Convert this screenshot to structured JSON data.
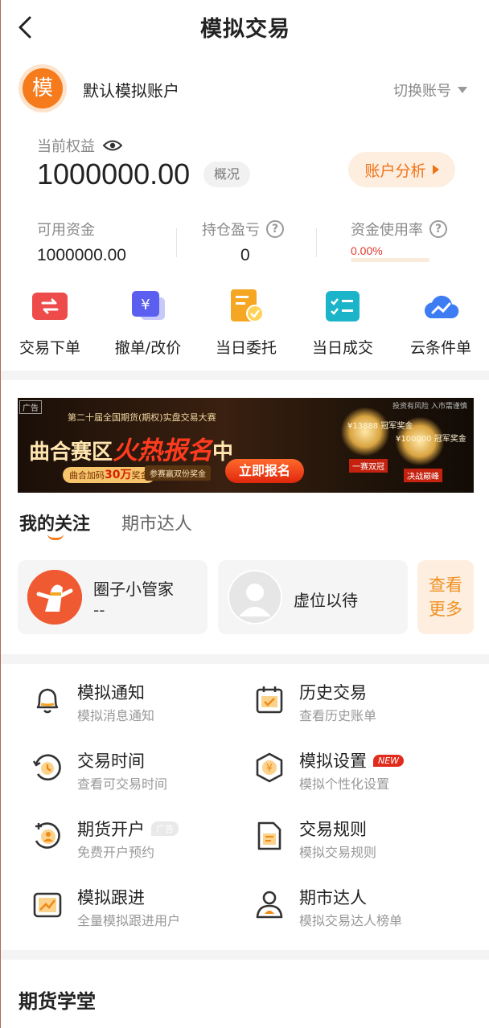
{
  "header": {
    "title": "模拟交易"
  },
  "account": {
    "avatar_char": "模",
    "name": "默认模拟账户",
    "switch_label": "切换账号",
    "equity_label": "当前权益",
    "equity_value": "1000000.00",
    "overview_label": "概况",
    "analysis_label": "账户分析",
    "stats": [
      {
        "label": "可用资金",
        "value": "1000000.00"
      },
      {
        "label": "持仓盈亏",
        "value": "0"
      },
      {
        "label": "资金使用率",
        "value": "0.00%",
        "progress": 0.0
      }
    ]
  },
  "actions": [
    {
      "label": "交易下单",
      "icon": "order-icon",
      "color": "#ee4b4b"
    },
    {
      "label": "撤单/改价",
      "icon": "cancel-yen-icon",
      "color": "#5b5ff0"
    },
    {
      "label": "当日委托",
      "icon": "entrust-icon",
      "color": "#f5a623"
    },
    {
      "label": "当日成交",
      "icon": "deal-list-icon",
      "color": "#1bb4c9"
    },
    {
      "label": "云条件单",
      "icon": "cloud-icon",
      "color": "#3d7cf3"
    }
  ],
  "banner": {
    "ad_tag": "广告",
    "top_text": "第二十届全国期货(期权)实盘交易大赛",
    "main_prefix": "曲合赛区",
    "main_hot": "火热报名",
    "main_suffix": "中",
    "bonus_prefix": "曲合加码",
    "bonus_amount": "30万",
    "bonus_suffix": "奖金",
    "sub2": "参赛赢双份奖金",
    "cta": "立即报名",
    "risk_note": "投资有风险 入市需谨慎",
    "trophy1_label": "¥13888 冠军奖金",
    "trophy2_label": "¥100000 冠军奖金",
    "tag1": "一赛双冠",
    "tag2": "决战巅峰"
  },
  "tabs": [
    {
      "label": "我的关注",
      "active": true
    },
    {
      "label": "期市达人",
      "active": false
    }
  ],
  "follow": {
    "cards": [
      {
        "name": "圈子小管家",
        "sub": "--"
      },
      {
        "name": "虚位以待",
        "sub": ""
      }
    ],
    "more_line1": "查看",
    "more_line2": "更多"
  },
  "menu": [
    {
      "title": "模拟通知",
      "sub": "模拟消息通知",
      "icon": "bell-icon",
      "badge": ""
    },
    {
      "title": "历史交易",
      "sub": "查看历史账单",
      "icon": "calendar-icon",
      "badge": ""
    },
    {
      "title": "交易时间",
      "sub": "查看可交易时间",
      "icon": "clock-icon",
      "badge": ""
    },
    {
      "title": "模拟设置",
      "sub": "模拟个性化设置",
      "icon": "settings-yen-icon",
      "badge": "NEW"
    },
    {
      "title": "期货开户",
      "sub": "免费开户预约",
      "icon": "open-account-icon",
      "badge": "广告"
    },
    {
      "title": "交易规则",
      "sub": "模拟交易规则",
      "icon": "rules-doc-icon",
      "badge": ""
    },
    {
      "title": "模拟跟进",
      "sub": "全量模拟跟进用户",
      "icon": "trend-icon",
      "badge": ""
    },
    {
      "title": "期市达人",
      "sub": "模拟交易达人榜单",
      "icon": "expert-icon",
      "badge": ""
    }
  ],
  "section": {
    "title": "期货学堂"
  }
}
